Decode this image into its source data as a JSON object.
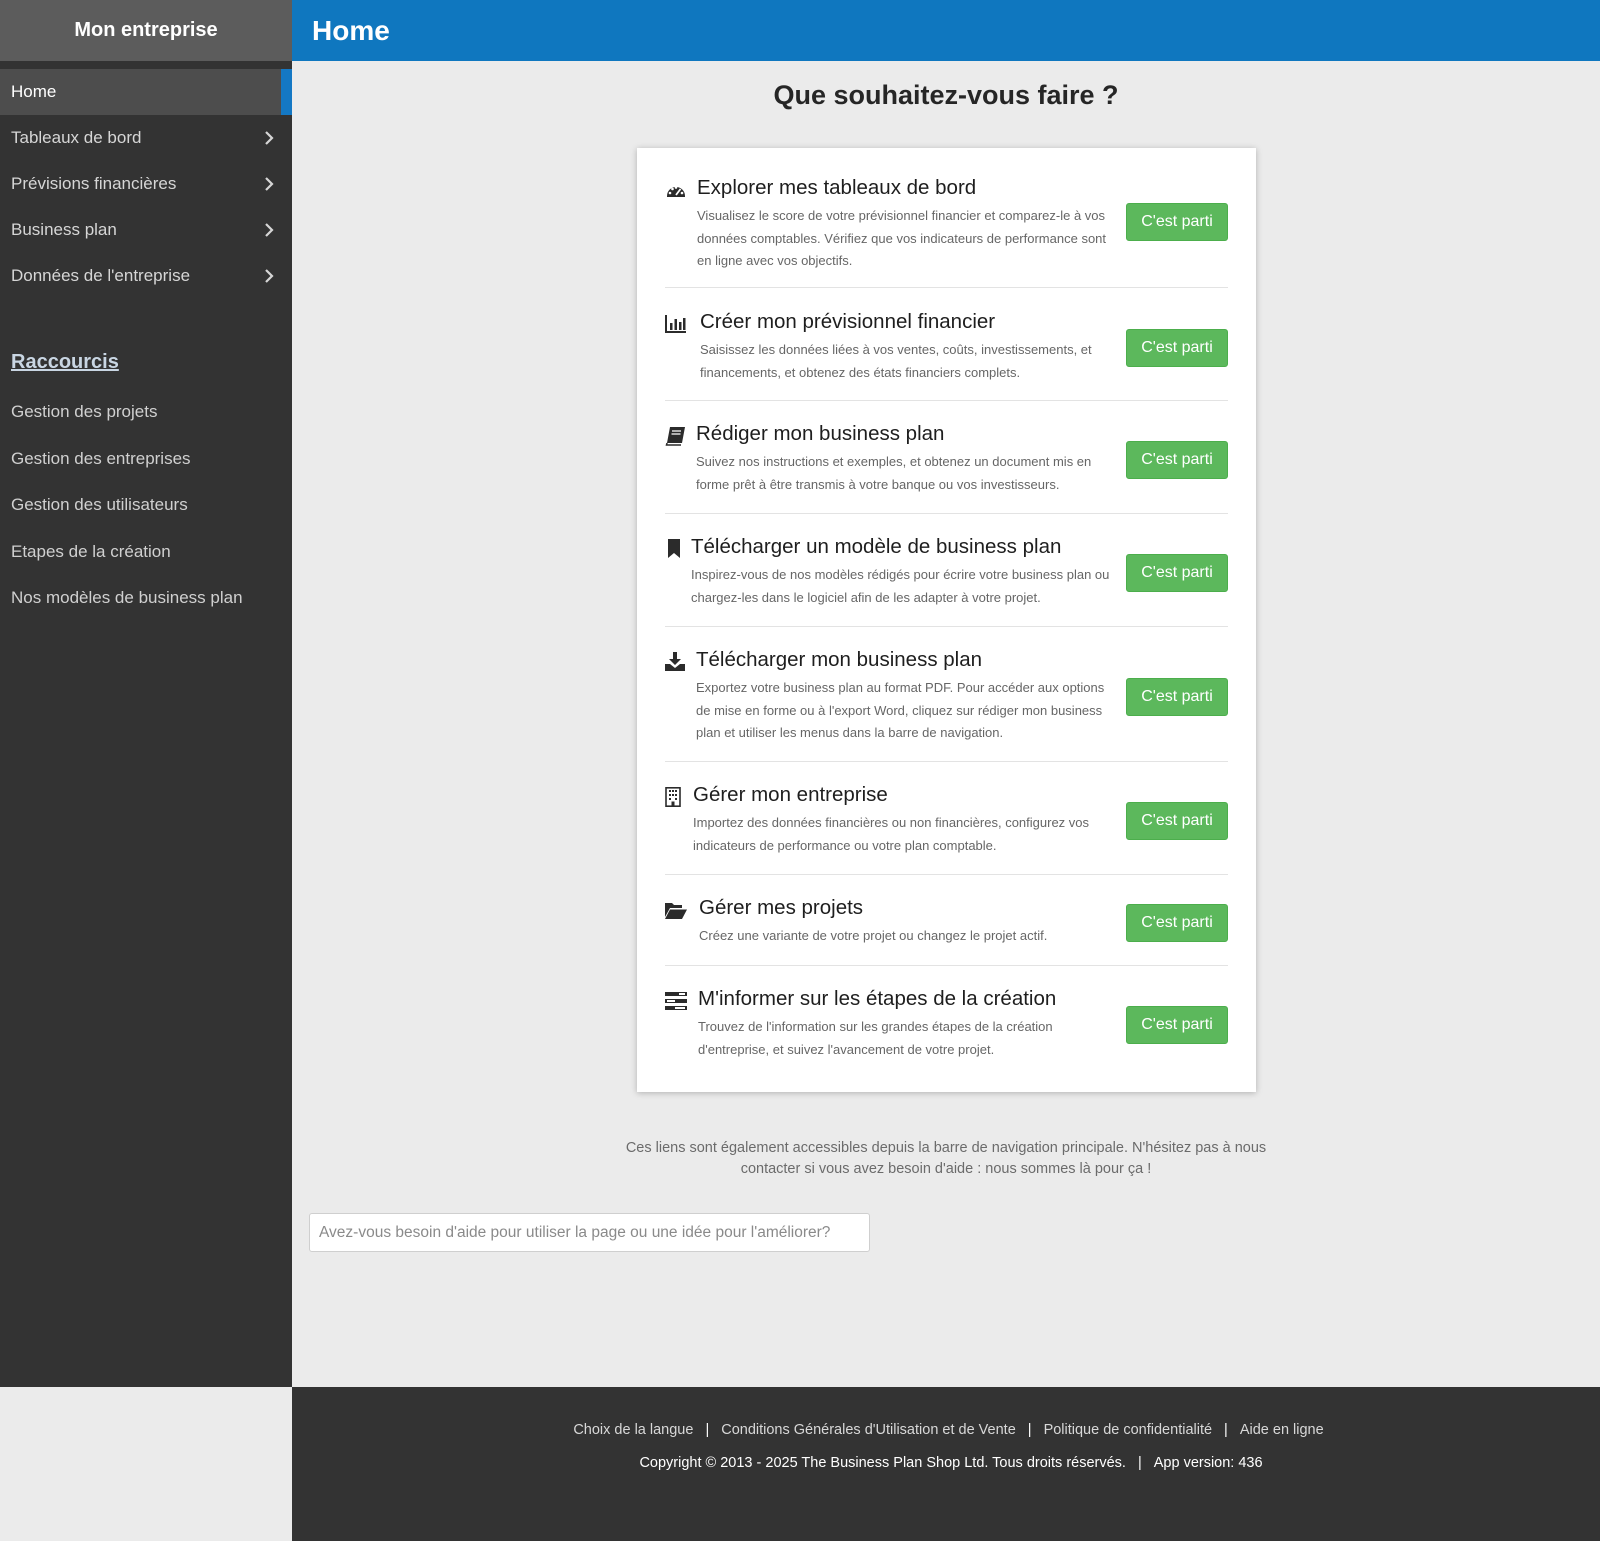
{
  "sidebar": {
    "brand": "Mon entreprise",
    "nav": [
      {
        "label": "Home",
        "active": true,
        "chevron": false
      },
      {
        "label": "Tableaux de bord",
        "chevron": true
      },
      {
        "label": "Prévisions financières",
        "chevron": true
      },
      {
        "label": "Business plan",
        "chevron": true
      },
      {
        "label": "Données de l'entreprise",
        "chevron": true
      }
    ],
    "shortcuts_title": "Raccourcis",
    "shortcuts": [
      "Gestion des projets",
      "Gestion des entreprises",
      "Gestion des utilisateurs",
      "Etapes de la création",
      "Nos modèles de business plan"
    ]
  },
  "header": {
    "title": "Home"
  },
  "main": {
    "title": "Que souhaitez-vous faire ?",
    "button_label": "C'est parti",
    "actions": [
      {
        "icon": "dashboard-gauge-icon",
        "title": "Explorer mes tableaux de bord",
        "desc": "Visualisez le score de votre prévisionnel financier et comparez-le à vos données comptables. Vérifiez que vos indicateurs de performance sont en ligne avec vos objectifs."
      },
      {
        "icon": "bar-chart-icon",
        "title": "Créer mon prévisionnel financier",
        "desc": "Saisissez les données liées à vos ventes, coûts, investissements, et financements, et obtenez des états financiers complets."
      },
      {
        "icon": "book-icon",
        "title": "Rédiger mon business plan",
        "desc": "Suivez nos instructions et exemples, et obtenez un document mis en forme prêt à être transmis à votre banque ou vos investisseurs."
      },
      {
        "icon": "bookmark-icon",
        "title": "Télécharger un modèle de business plan",
        "desc": "Inspirez-vous de nos modèles rédigés pour écrire votre business plan ou chargez-les dans le logiciel afin de les adapter à votre projet."
      },
      {
        "icon": "download-icon",
        "title": "Télécharger mon business plan",
        "desc": "Exportez votre business plan au format PDF. Pour accéder aux options de mise en forme ou à l'export Word, cliquez sur rédiger mon business plan et utiliser les menus dans la barre de navigation."
      },
      {
        "icon": "building-icon",
        "title": "Gérer mon entreprise",
        "desc": "Importez des données financières ou non financières, configurez vos indicateurs de performance ou votre plan comptable."
      },
      {
        "icon": "folder-open-icon",
        "title": "Gérer mes projets",
        "desc": "Créez une variante de votre projet ou changez le projet actif."
      },
      {
        "icon": "tasks-icon",
        "title": "M'informer sur les étapes de la création",
        "desc": "Trouvez de l'information sur les grandes étapes de la création d'entreprise, et suivez l'avancement de votre projet."
      }
    ],
    "info": "Ces liens sont également accessibles depuis la barre de navigation principale. N'hésitez pas à nous contacter si vous avez besoin d'aide : nous sommes là pour ça !",
    "help_placeholder": "Avez-vous besoin d'aide pour utiliser la page ou une idée pour l'améliorer?"
  },
  "footer": {
    "links": [
      "Choix de la langue",
      "Conditions Générales d'Utilisation et de Vente",
      "Politique de confidentialité",
      "Aide en ligne"
    ],
    "copyright": "Copyright © 2013 - 2025 The Business Plan Shop Ltd. Tous droits réservés.",
    "app_version": "App version: 436"
  },
  "colors": {
    "accent": "#0f77bf",
    "button": "#5cb85c",
    "sidebar": "#333333"
  }
}
